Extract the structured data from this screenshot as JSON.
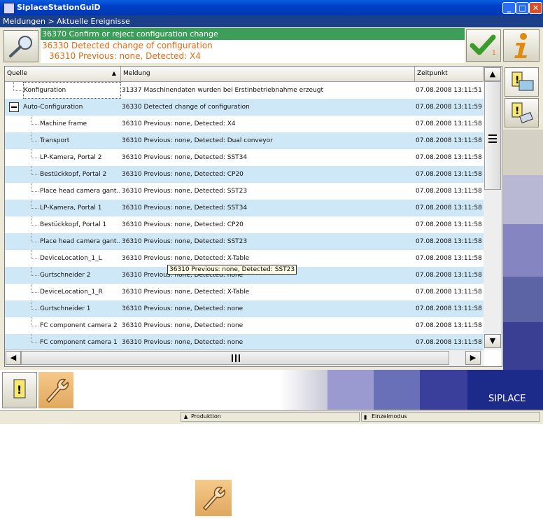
{
  "window": {
    "title": "SiplaceStationGuiD",
    "controls": [
      "_",
      "□",
      "✕"
    ]
  },
  "breadcrumb": "Meldungen > Aktuelle Ereignisse",
  "messages": {
    "active": "36370 Confirm or reject configuration change",
    "line1": "36330 Detected change of configuration",
    "line2": "36310 Previous: none, Detected: X4",
    "count": "1"
  },
  "table": {
    "columns": [
      "Quelle",
      "Meldung",
      "Zeitpunkt"
    ],
    "rows": [
      {
        "source": "Konfiguration",
        "message": "31337 Maschinendaten wurden bei Erstinbetriebnahme erzeugt",
        "time": "07.08.2008 13:11:51"
      },
      {
        "source": "Auto-Configuration",
        "message": "36330 Detected change of configuration",
        "time": "07.08.2008 13:11:59"
      },
      {
        "source": "Machine frame",
        "message": "36310 Previous: none, Detected: X4",
        "time": "07.08.2008 13:11:58"
      },
      {
        "source": "Transport",
        "message": "36310 Previous: none, Detected: Dual conveyor",
        "time": "07.08.2008 13:11:58"
      },
      {
        "source": "LP-Kamera, Portal 2",
        "message": "36310 Previous: none, Detected: SST34",
        "time": "07.08.2008 13:11:58"
      },
      {
        "source": "Bestückkopf, Portal 2",
        "message": "36310 Previous: none, Detected: CP20",
        "time": "07.08.2008 13:11:58"
      },
      {
        "source": "Place head camera gant…",
        "message": "36310 Previous: none, Detected: SST23",
        "time": "07.08.2008 13:11:58"
      },
      {
        "source": "LP-Kamera, Portal 1",
        "message": "36310 Previous: none, Detected: SST34",
        "time": "07.08.2008 13:11:58"
      },
      {
        "source": "Bestückkopf, Portal 1",
        "message": "36310 Previous: none, Detected: CP20",
        "time": "07.08.2008 13:11:58"
      },
      {
        "source": "Place head camera gant…",
        "message": "36310 Previous: none, Detected: SST23",
        "time": "07.08.2008 13:11:58"
      },
      {
        "source": "DeviceLocation_1_L",
        "message": "36310 Previous: none, Detected: X-Table",
        "time": "07.08.2008 13:11:58"
      },
      {
        "source": "Gurtschneider 2",
        "message": "36310 Previous: none, Detected: none",
        "time": "07.08.2008 13:11:58"
      },
      {
        "source": "DeviceLocation_1_R",
        "message": "36310 Previous: none, Detected: X-Table",
        "time": "07.08.2008 13:11:58"
      },
      {
        "source": "Gurtschneider 1",
        "message": "36310 Previous: none, Detected: none",
        "time": "07.08.2008 13:11:58"
      },
      {
        "source": "FC component camera 2",
        "message": "36310 Previous: none, Detected: none",
        "time": "07.08.2008 13:11:58"
      },
      {
        "source": "FC component camera 1",
        "message": "36310 Previous: none, Detected: none",
        "time": "07.08.2008 13:11:58"
      }
    ]
  },
  "tooltip": "36310 Previous: none, Detected: SST23",
  "brand": "SIPLACE",
  "status": {
    "production": "Produktion",
    "mode": "Einzelmodus"
  },
  "colors": {
    "green_bar": "#3d9e5a",
    "orange_text": "#e46a10",
    "row_alt": "#cfe8f7",
    "brand_blue": "#1c2a8a"
  },
  "icons": [
    "search-icon",
    "checkmark-icon",
    "info-icon",
    "message-list-icon",
    "message-settings-icon",
    "wrench-icon"
  ]
}
